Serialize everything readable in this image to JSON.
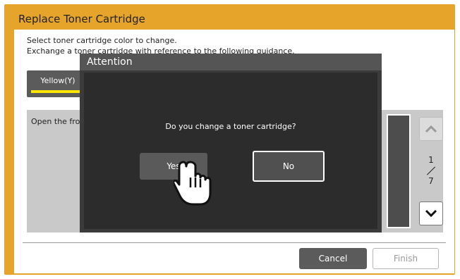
{
  "window": {
    "title": "Replace Toner Cartridge"
  },
  "instructions": {
    "line1": "Select toner cartridge color to change.",
    "line2": "Exchange a toner cartridge with reference to the following guidance."
  },
  "color_tabs": [
    {
      "label": "Yellow(Y)",
      "color": "#ffe600"
    }
  ],
  "guidance": {
    "text": "Open the front cover."
  },
  "pager": {
    "current": "1",
    "total": "7",
    "up_icon": "chevron-up-icon",
    "down_icon": "chevron-down-icon"
  },
  "footer": {
    "cancel_label": "Cancel",
    "finish_label": "Finish"
  },
  "dialog": {
    "title": "Attention",
    "message": "Do you change a toner cartridge?",
    "yes_label": "Yes",
    "no_label": "No"
  },
  "colors": {
    "frame": "#e6a42a",
    "dialog_bg": "#2c2c2c",
    "button_dark": "#5b5b5b",
    "toner_yellow": "#ffe600"
  },
  "cursor_icon": "hand-pointer-icon"
}
